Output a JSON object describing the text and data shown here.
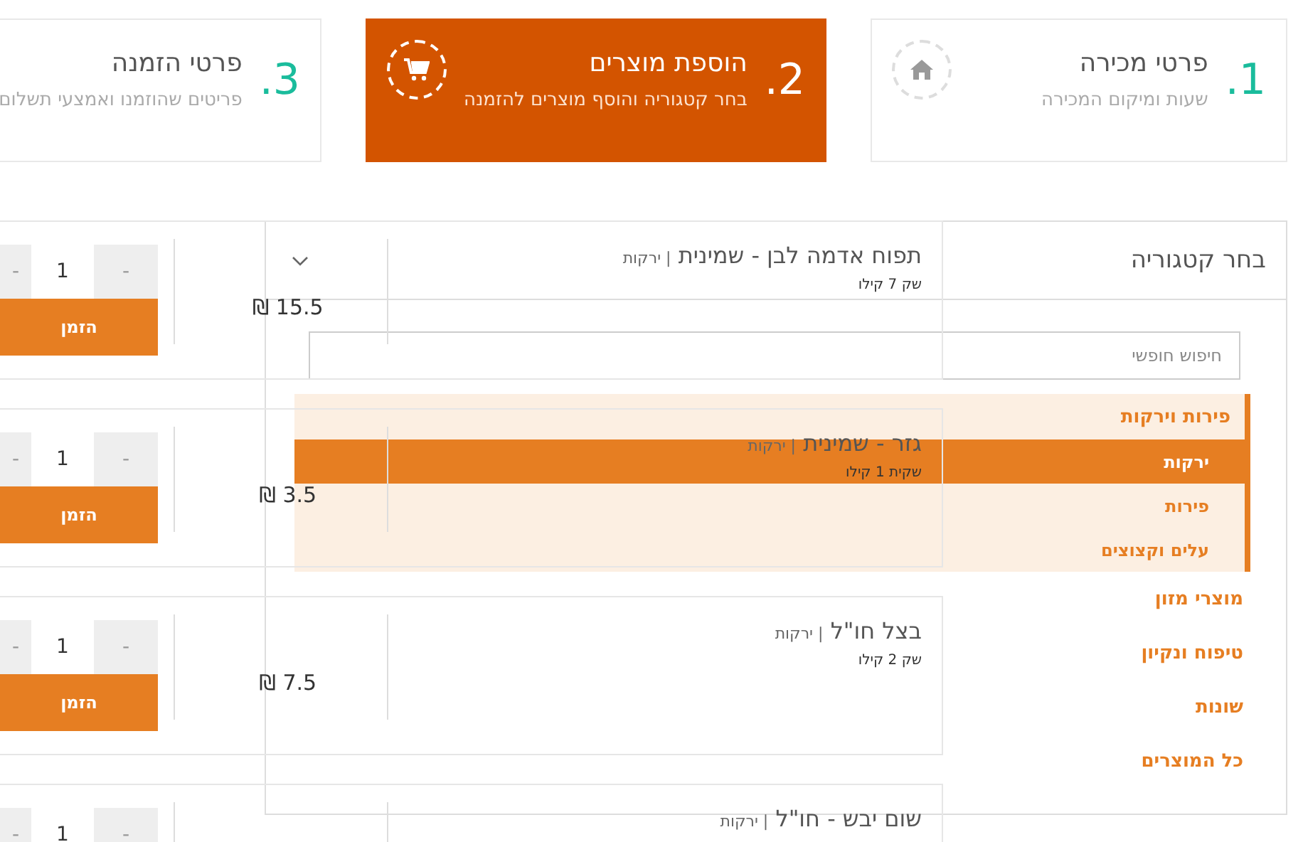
{
  "steps": [
    {
      "number": "1.",
      "title": "פרטי מכירה",
      "subtitle": "שעות ומיקום המכירה",
      "selected": false
    },
    {
      "number": "2.",
      "title": "הוספת מוצרים",
      "subtitle": "בחר קטגוריה והוסף מוצרים להזמנה",
      "selected": true
    },
    {
      "number": "3.",
      "title": "פרטי הזמנה",
      "subtitle": "פריטים שהוזמנו ואמצעי תשלום",
      "selected": false
    }
  ],
  "products": [
    {
      "name": "תפוח אדמה לבן - שמינית",
      "category": "| ירקות",
      "unit": "שק 7 קילו",
      "price": "₪ 15.5",
      "quantity": "1",
      "minus_label": "-",
      "plus_label": "-",
      "order_label": "הזמן"
    },
    {
      "name": "גזר - שמינית",
      "category": "| ירקות",
      "unit": "שקית 1 קילו",
      "price": "₪ 3.5",
      "quantity": "1",
      "minus_label": "-",
      "plus_label": "-",
      "order_label": "הזמן"
    },
    {
      "name": "בצל חו\"ל",
      "category": "| ירקות",
      "unit": "שק 2 קילו",
      "price": "₪ 7.5",
      "quantity": "1",
      "minus_label": "-",
      "plus_label": "-",
      "order_label": "הזמן"
    },
    {
      "name": "שום יבש - חו\"ל",
      "category": "| ירקות",
      "quantity": "1",
      "minus_label": "-",
      "plus_label": "-"
    }
  ],
  "category_panel": {
    "title": "בחר קטגוריה",
    "search": {
      "placeholder": "חיפוש חופשי"
    },
    "categories": [
      {
        "label": "פירות וירקות",
        "expanded": true,
        "children": [
          {
            "label": "ירקות",
            "selected": true
          },
          {
            "label": "פירות",
            "selected": false
          },
          {
            "label": "עלים וקצוצים",
            "selected": false
          }
        ]
      },
      {
        "label": "מוצרי מזון",
        "expanded": false
      },
      {
        "label": "טיפוח ונקיון",
        "expanded": false
      },
      {
        "label": "שונות",
        "expanded": false
      },
      {
        "label": "כל המוצרים",
        "expanded": false
      }
    ]
  }
}
